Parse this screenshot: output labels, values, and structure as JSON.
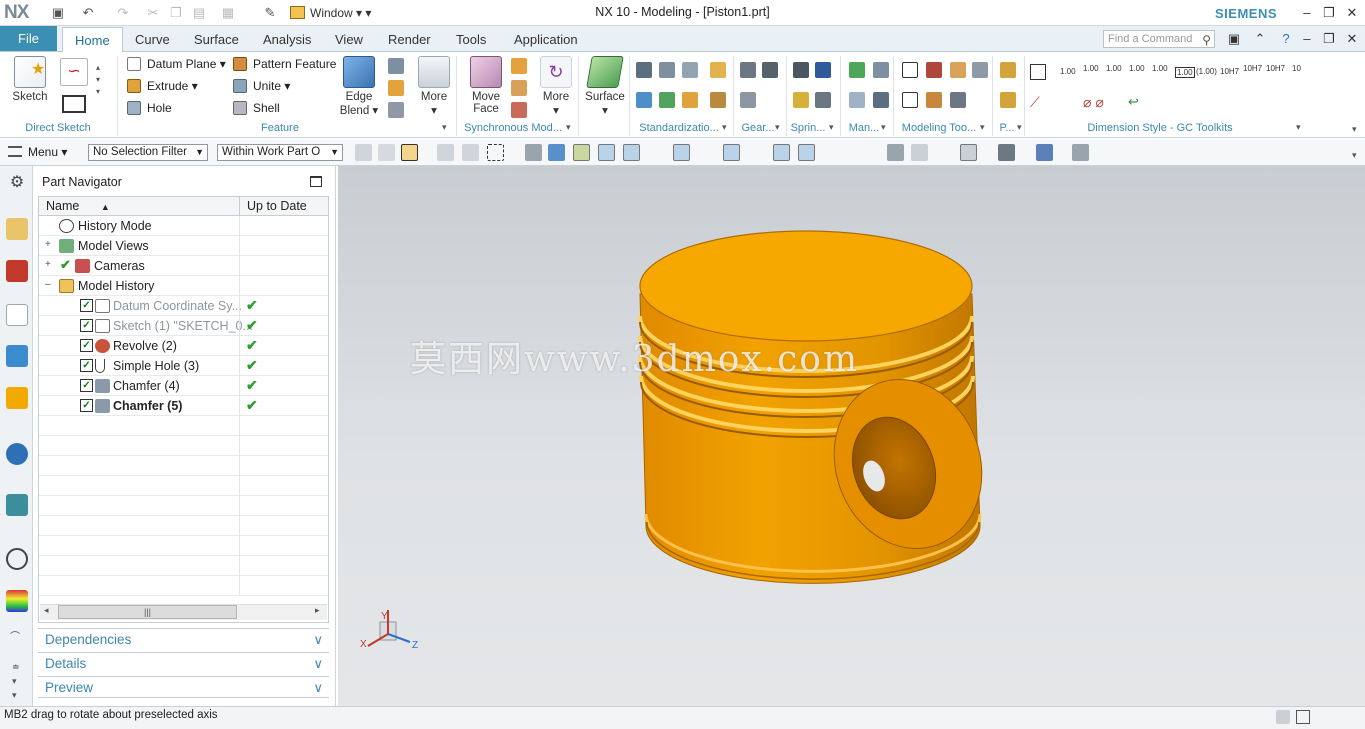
{
  "app": {
    "logo": "NX",
    "title": "NX 10 - Modeling - [Piston1.prt]",
    "brand": "SIEMENS",
    "window_menu": "Window"
  },
  "tabs": {
    "file": "File",
    "items": [
      "Home",
      "Curve",
      "Surface",
      "Analysis",
      "View",
      "Render",
      "Tools",
      "Application"
    ],
    "active": "Home"
  },
  "search": {
    "placeholder": "Find a Command"
  },
  "ribbon": {
    "sketch": "Sketch",
    "direct_sketch": "Direct Sketch",
    "datum_plane": "Datum Plane",
    "extrude": "Extrude",
    "hole": "Hole",
    "pattern_feature": "Pattern Feature",
    "unite": "Unite",
    "shell": "Shell",
    "edge_blend_1": "Edge",
    "edge_blend_2": "Blend",
    "more1": "More",
    "feature": "Feature",
    "move_face_1": "Move",
    "move_face_2": "Face",
    "more2": "More",
    "synchronous": "Synchronous Mod...",
    "surface": "Surface",
    "standardization": "Standardizatio...",
    "gear": "Gear...",
    "spring": "Sprin...",
    "man": "Man...",
    "modeling_tools": "Modeling Too...",
    "p": "P...",
    "dimension_style": "Dimension Style - GC Toolkits",
    "dim_labels": [
      "1.00",
      "1.00",
      "1.00",
      "1.00",
      "1.00",
      "1.00",
      "(1.00)",
      "10H7",
      "10H7",
      "10H7",
      "10"
    ]
  },
  "selection_bar": {
    "menu": "Menu",
    "filter": "No Selection Filter",
    "scope": "Within Work Part O"
  },
  "navigator": {
    "title": "Part Navigator",
    "col_name": "Name",
    "col_uptodate": "Up to Date",
    "rows": [
      {
        "label": "History Mode"
      },
      {
        "label": "Model Views"
      },
      {
        "label": "Cameras"
      },
      {
        "label": "Model History"
      },
      {
        "label": "Datum Coordinate Sy..."
      },
      {
        "label": "Sketch (1) \"SKETCH_0..."
      },
      {
        "label": "Revolve (2)"
      },
      {
        "label": "Simple Hole (3)"
      },
      {
        "label": "Chamfer (4)"
      },
      {
        "label": "Chamfer (5)"
      }
    ],
    "scroll_grip": "|||",
    "panels": [
      "Dependencies",
      "Details",
      "Preview"
    ]
  },
  "viewport": {
    "watermark": "莫西网www.3dmox.com",
    "axes": {
      "x": "X",
      "y": "Y",
      "z": "Z"
    },
    "model_color": "#f5a800"
  },
  "status": {
    "text": "MB2 drag to rotate about preselected axis"
  }
}
